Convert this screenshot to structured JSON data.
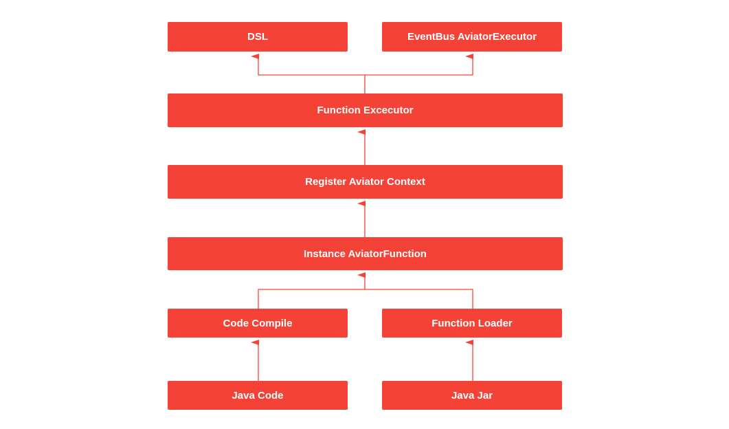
{
  "colors": {
    "node_fill": "#f44336",
    "edge": "#f44336",
    "text": "#ffffff"
  },
  "nodes": {
    "dsl": "DSL",
    "eventbus": "EventBus AviatorExecutor",
    "function_executor": "Function Excecutor",
    "register_context": "Register Aviator Context",
    "instance_function": "Instance AviatorFunction",
    "code_compile": "Code Compile",
    "function_loader": "Function Loader",
    "java_code": "Java Code",
    "java_jar": "Java Jar"
  },
  "edges": [
    {
      "from": "function_executor",
      "to": "dsl"
    },
    {
      "from": "function_executor",
      "to": "eventbus"
    },
    {
      "from": "register_context",
      "to": "function_executor"
    },
    {
      "from": "instance_function",
      "to": "register_context"
    },
    {
      "from": "code_compile",
      "to": "instance_function"
    },
    {
      "from": "function_loader",
      "to": "instance_function"
    },
    {
      "from": "java_code",
      "to": "code_compile"
    },
    {
      "from": "java_jar",
      "to": "function_loader"
    }
  ]
}
